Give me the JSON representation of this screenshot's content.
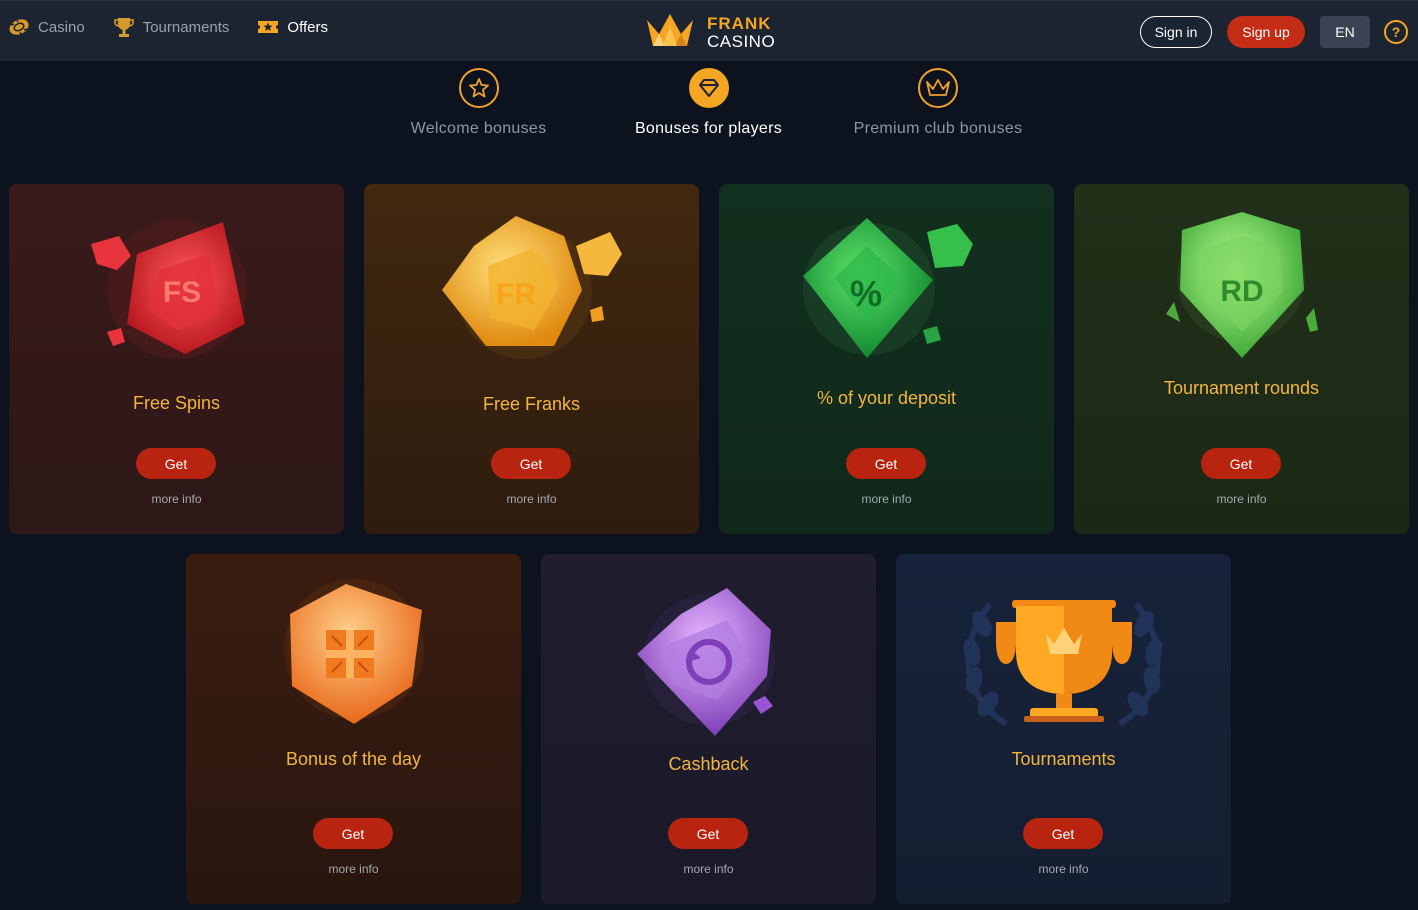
{
  "header": {
    "nav": [
      {
        "label": "Casino",
        "icon": "casino-chip-icon"
      },
      {
        "label": "Tournaments",
        "icon": "trophy-icon"
      },
      {
        "label": "Offers",
        "icon": "ticket-star-icon"
      }
    ],
    "logo": {
      "line1": "FRANK",
      "line2": "CASINO"
    },
    "signin_label": "Sign in",
    "signup_label": "Sign up",
    "lang_label": "EN",
    "help_label": "?"
  },
  "tabs": [
    {
      "label": "Welcome bonuses",
      "icon": "star-icon",
      "active": false
    },
    {
      "label": "Bonuses for players",
      "icon": "diamond-icon",
      "active": true
    },
    {
      "label": "Premium club bonuses",
      "icon": "crown-icon",
      "active": false
    }
  ],
  "cards": [
    {
      "title": "Free Spins",
      "gem_text": "FS",
      "get_label": "Get",
      "more_label": "more info"
    },
    {
      "title": "Free Franks",
      "gem_text": "FR",
      "get_label": "Get",
      "more_label": "more info"
    },
    {
      "title": "% of your deposit",
      "gem_text": "%",
      "get_label": "Get",
      "more_label": "more info"
    },
    {
      "title": "Tournament rounds",
      "gem_text": "RD",
      "get_label": "Get",
      "more_label": "more info"
    },
    {
      "title": "Bonus of the day",
      "gem_text": "",
      "get_label": "Get",
      "more_label": "more info"
    },
    {
      "title": "Cashback",
      "gem_text": "",
      "get_label": "Get",
      "more_label": "more info"
    },
    {
      "title": "Tournaments",
      "gem_text": "",
      "get_label": "Get",
      "more_label": "more info"
    }
  ],
  "colors": {
    "accent": "#f5a623",
    "button_red": "#c52c16",
    "background": "#0d131e"
  }
}
